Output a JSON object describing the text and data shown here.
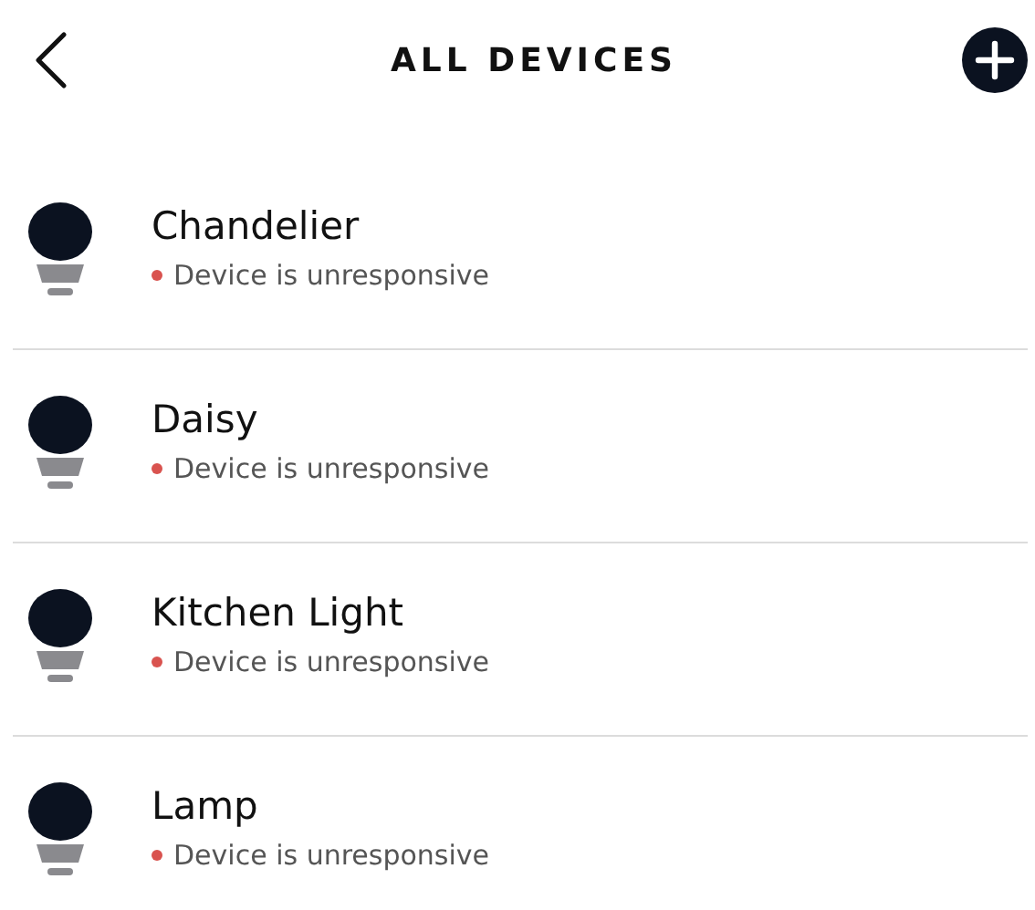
{
  "header": {
    "title": "ALL DEVICES"
  },
  "devices": [
    {
      "name": "Chandelier",
      "status": "Device is unresponsive"
    },
    {
      "name": "Daisy",
      "status": "Device is unresponsive"
    },
    {
      "name": "Kitchen Light",
      "status": "Device is unresponsive"
    },
    {
      "name": "Lamp",
      "status": "Device is unresponsive"
    }
  ]
}
